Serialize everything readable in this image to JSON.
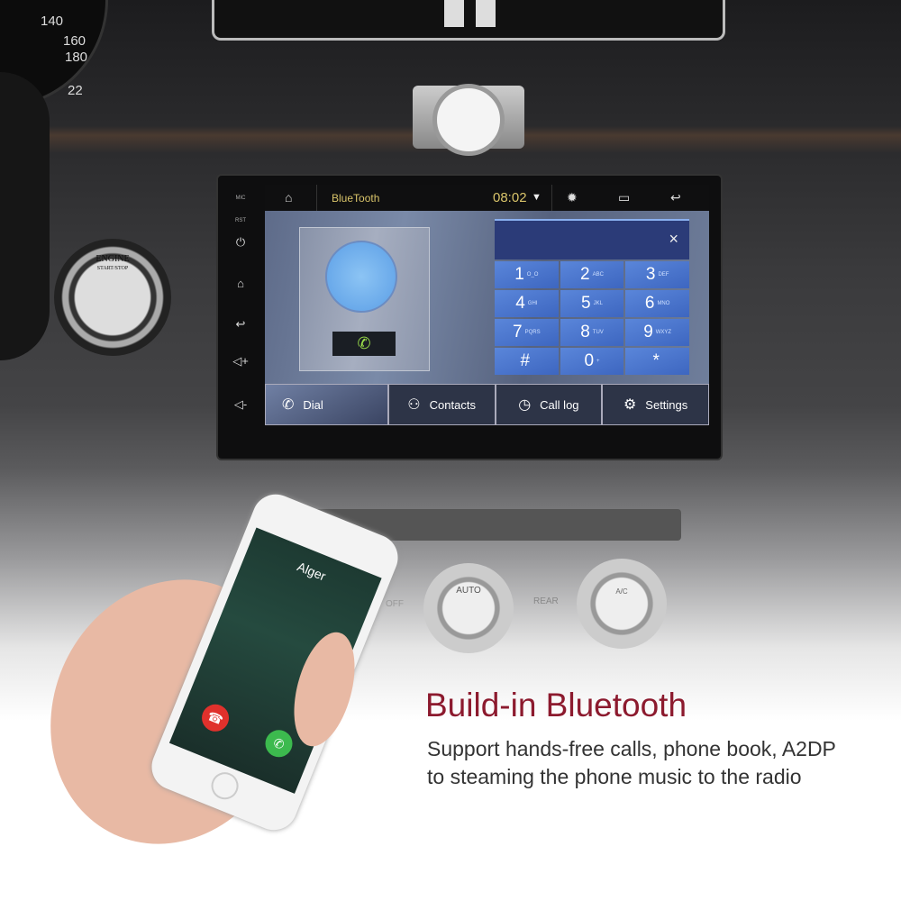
{
  "dashboard": {
    "gauge_ticks": [
      "140",
      "160",
      "180",
      "22"
    ],
    "engine_button": {
      "line1": "ENGINE",
      "line2": "START/STOP"
    }
  },
  "head_unit": {
    "side_labels": {
      "mic": "MIC",
      "rst": "RST"
    },
    "side_icons": [
      "power-icon",
      "home-icon",
      "back-icon",
      "volume-up-icon",
      "volume-down-icon"
    ],
    "status_bar": {
      "app_title": "BlueTooth",
      "time": "08:02"
    },
    "dialpad": {
      "clear": "×",
      "keys": [
        {
          "digit": "1",
          "letters": "O_O"
        },
        {
          "digit": "2",
          "letters": "ABC"
        },
        {
          "digit": "3",
          "letters": "DEF"
        },
        {
          "digit": "4",
          "letters": "GHI"
        },
        {
          "digit": "5",
          "letters": "JKL"
        },
        {
          "digit": "6",
          "letters": "MNO"
        },
        {
          "digit": "7",
          "letters": "PQRS"
        },
        {
          "digit": "8",
          "letters": "TUV"
        },
        {
          "digit": "9",
          "letters": "WXYZ"
        },
        {
          "digit": "#",
          "letters": ""
        },
        {
          "digit": "0",
          "letters": "+"
        },
        {
          "digit": "*",
          "letters": ""
        }
      ]
    },
    "tabs": [
      {
        "label": "Dial",
        "icon": "phone-icon",
        "active": true
      },
      {
        "label": "Contacts",
        "icon": "person-icon"
      },
      {
        "label": "Call log",
        "icon": "clock-icon"
      },
      {
        "label": "Settings",
        "icon": "gear-icon"
      }
    ]
  },
  "climate": {
    "auto": "AUTO",
    "off": "OFF",
    "rear": "REAR",
    "ac": "A/C"
  },
  "phone": {
    "caller": "Alger"
  },
  "marketing": {
    "headline": "Build-in Bluetooth",
    "line1": "Support hands-free calls, phone book, A2DP",
    "line2": "to steaming the phone music to the radio"
  },
  "colors": {
    "headline": "#8c1a2e",
    "keypad": "#4a74cc",
    "accent_gold": "#d9c46a"
  }
}
